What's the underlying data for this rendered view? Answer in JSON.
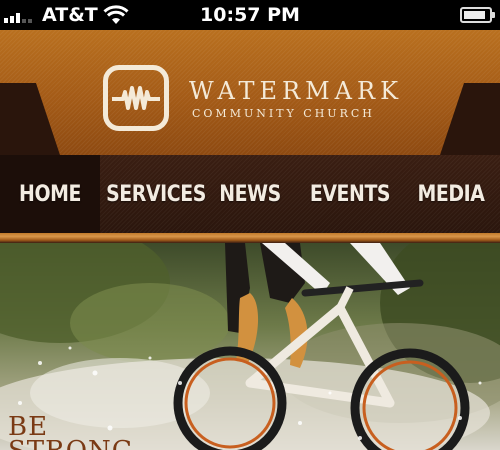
{
  "status_bar": {
    "carrier": "AT&T",
    "time": "10:57 PM",
    "signal_bars": 3,
    "battery_level": 0.75,
    "icons": [
      "signal-icon",
      "wifi-icon",
      "battery-icon"
    ]
  },
  "brand": {
    "name": "WATERMARK",
    "subtitle": "COMMUNITY CHURCH",
    "logo_icon": "watermark-logo-icon",
    "colors": {
      "header": "#a45b17",
      "nav": "#2b160d",
      "text": "#f4ead8"
    }
  },
  "nav": {
    "items": [
      {
        "label": "HOME",
        "active": true
      },
      {
        "label": "SERVICES",
        "active": false
      },
      {
        "label": "NEWS",
        "active": false
      },
      {
        "label": "EVENTS",
        "active": false
      },
      {
        "label": "MEDIA",
        "active": false
      }
    ]
  },
  "hero": {
    "line1": "BE",
    "line2": "STRONG"
  }
}
